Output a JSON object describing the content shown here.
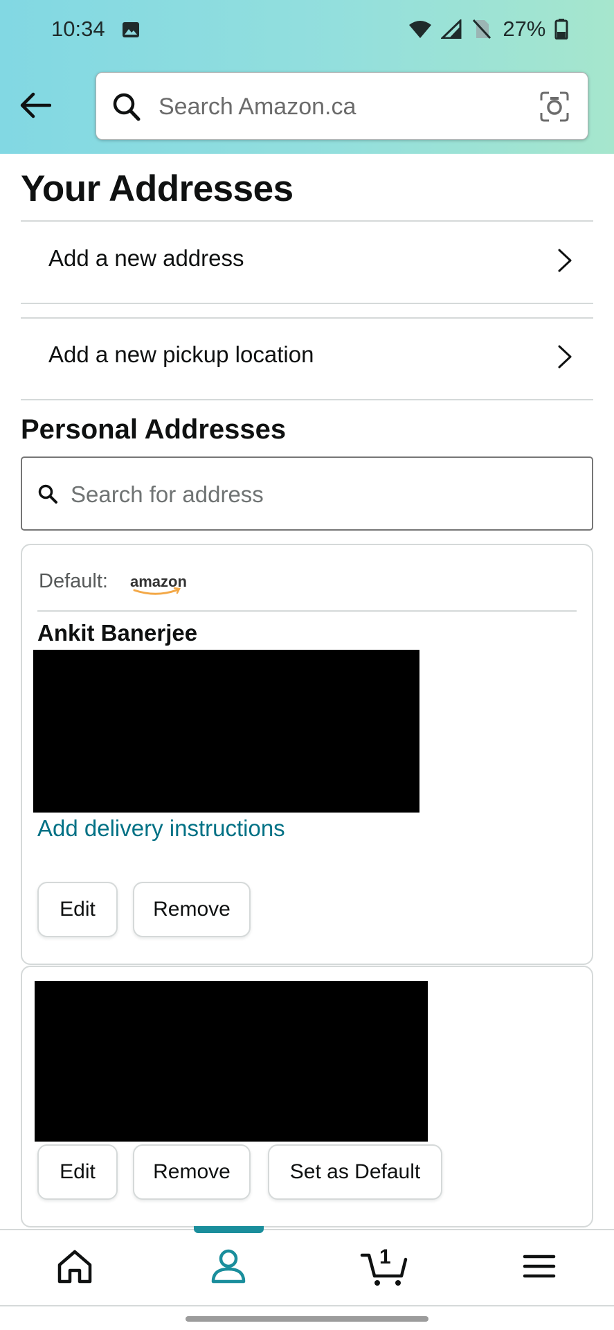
{
  "status_bar": {
    "time": "10:34",
    "battery": "27%"
  },
  "search": {
    "placeholder": "Search Amazon.ca"
  },
  "page": {
    "title": "Your Addresses"
  },
  "menu": {
    "add_address": "Add a new address",
    "add_pickup": "Add a new pickup location"
  },
  "personal": {
    "title": "Personal Addresses",
    "search_placeholder": "Search for address"
  },
  "cards": [
    {
      "default_label": "Default:",
      "name": "Ankit Banerjee",
      "link": "Add delivery instructions",
      "buttons": [
        "Edit",
        "Remove"
      ]
    },
    {
      "buttons": [
        "Edit",
        "Remove",
        "Set as Default"
      ]
    }
  ],
  "nav": {
    "cart_count": "1",
    "active": "account"
  },
  "colors": {
    "accent": "#007185",
    "nav_accent": "#1a8e9c"
  }
}
